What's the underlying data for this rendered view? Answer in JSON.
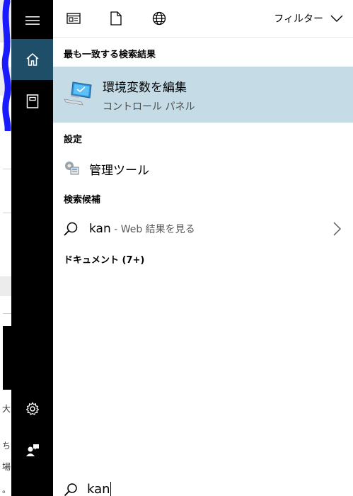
{
  "rail": {
    "items": [
      "menu-icon",
      "home-icon",
      "notebook-icon",
      "settings-icon",
      "feedback-icon"
    ]
  },
  "topbar": {
    "icons": [
      "apps-filter-icon",
      "documents-filter-icon",
      "web-filter-icon"
    ],
    "filter_label": "フィルター"
  },
  "sections": {
    "best_match": "最も一致する検索結果",
    "settings": "設定",
    "suggestions": "検索候補",
    "documents": "ドキュメント (7+)"
  },
  "best_match": {
    "title": "環境変数を編集",
    "subtitle": "コントロール パネル"
  },
  "settings_item": {
    "label": "管理ツール"
  },
  "web_suggestion": {
    "query": "kan",
    "suffix": " - Web 結果を見る"
  },
  "search": {
    "value": "kan"
  },
  "background_chars": [
    "大",
    "ち",
    "場",
    "。"
  ],
  "colors": {
    "rail": "#000000",
    "rail_active": "#1f4e68",
    "highlight": "#c5dce6",
    "marker": "#1a1aff"
  }
}
